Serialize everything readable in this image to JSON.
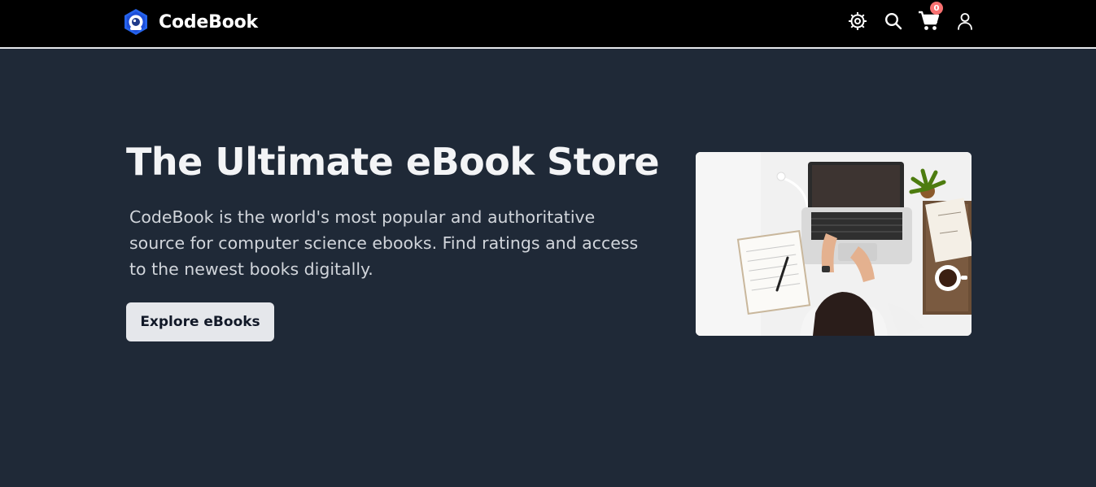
{
  "header": {
    "brand_name": "CodeBook",
    "logo_icon": "codebook-logo-icon",
    "icons": {
      "settings": "gear-icon",
      "search": "search-icon",
      "cart": "cart-icon",
      "account": "user-icon"
    },
    "cart_count": "0"
  },
  "hero": {
    "title": "The Ultimate eBook Store",
    "description": "CodeBook is the world's most popular and authoritative source for computer science ebooks. Find ratings and access to the newest books digitally.",
    "cta_label": "Explore eBooks",
    "image_alt": "Person typing on a laptop at a white desk with a notebook, plant, books and a cup of tea"
  },
  "colors": {
    "page_background": "#1f2937",
    "navbar_background": "#000000",
    "button_background": "#e5e7eb",
    "badge": "#f87171"
  }
}
